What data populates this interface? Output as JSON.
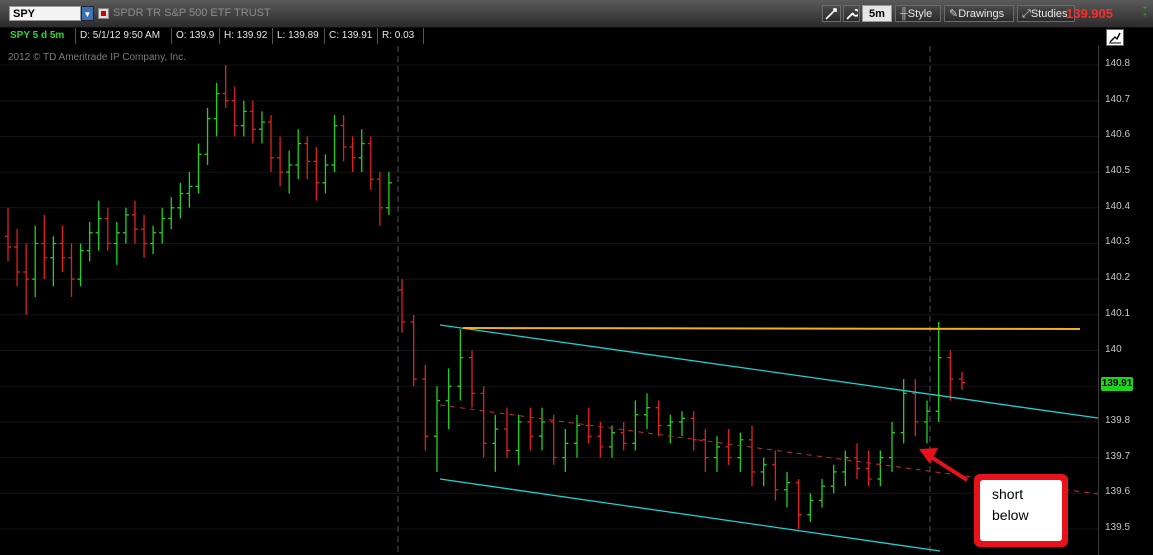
{
  "header": {
    "symbol": "SPY",
    "description": "SPDR TR S&P 500 ETF TRUST",
    "period_button": "5m",
    "style_label": "Style",
    "drawings_label": "Drawings",
    "studies_label": "Studies",
    "last_price": "139.905",
    "mini_change": "+0\n+0"
  },
  "info": {
    "chart_id": "SPY 5 d 5m",
    "date": "D: 5/1/12 9:50 AM",
    "open": "O: 139.9",
    "high": "H: 139.92",
    "low": "L: 139.89",
    "close": "C: 139.91",
    "range": "R: 0.03"
  },
  "copyright": "2012 © TD Ameritrade IP Company, Inc.",
  "annotation": {
    "line1": "short",
    "line2": "below"
  },
  "colors": {
    "up": "#22d022",
    "down": "#e02020",
    "channel": "#1fd0d0",
    "resistance": "#f0b020",
    "price_badge": "#1fd41f"
  },
  "chart_data": {
    "type": "candlestick",
    "ylim": [
      139.46,
      140.85
    ],
    "y_ticks": [
      "140.8",
      "140.7",
      "140.6",
      "140.5",
      "140.4",
      "140.3",
      "140.2",
      "140.1",
      "140",
      "139.9",
      "139.8",
      "139.7",
      "139.6",
      "139.5"
    ],
    "current_price_label": "139.91",
    "bars": [
      [
        140.32,
        140.4,
        140.25,
        140.29
      ],
      [
        140.29,
        140.34,
        140.18,
        140.22
      ],
      [
        140.22,
        140.3,
        140.1,
        140.2
      ],
      [
        140.2,
        140.35,
        140.15,
        140.3
      ],
      [
        140.3,
        140.38,
        140.2,
        140.26
      ],
      [
        140.26,
        140.32,
        140.18,
        140.3
      ],
      [
        140.3,
        140.35,
        140.22,
        140.26
      ],
      [
        140.26,
        140.3,
        140.15,
        140.2
      ],
      [
        140.2,
        140.3,
        140.18,
        140.28
      ],
      [
        140.28,
        140.36,
        140.25,
        140.33
      ],
      [
        140.33,
        140.42,
        140.28,
        140.37
      ],
      [
        140.37,
        140.4,
        140.28,
        140.3
      ],
      [
        140.3,
        140.36,
        140.24,
        140.33
      ],
      [
        140.33,
        140.4,
        140.3,
        140.38
      ],
      [
        140.38,
        140.42,
        140.3,
        140.34
      ],
      [
        140.34,
        140.38,
        140.26,
        140.3
      ],
      [
        140.3,
        140.35,
        140.27,
        140.33
      ],
      [
        140.33,
        140.4,
        140.3,
        140.37
      ],
      [
        140.37,
        140.43,
        140.34,
        140.4
      ],
      [
        140.4,
        140.47,
        140.37,
        140.44
      ],
      [
        140.44,
        140.5,
        140.4,
        140.46
      ],
      [
        140.46,
        140.58,
        140.44,
        140.55
      ],
      [
        140.55,
        140.68,
        140.52,
        140.65
      ],
      [
        140.65,
        140.75,
        140.6,
        140.72
      ],
      [
        140.72,
        140.8,
        140.68,
        140.7
      ],
      [
        140.7,
        140.74,
        140.6,
        140.63
      ],
      [
        140.63,
        140.7,
        140.6,
        140.67
      ],
      [
        140.67,
        140.7,
        140.58,
        140.62
      ],
      [
        140.62,
        140.67,
        140.58,
        140.64
      ],
      [
        140.64,
        140.66,
        140.5,
        140.54
      ],
      [
        140.54,
        140.6,
        140.46,
        140.5
      ],
      [
        140.5,
        140.56,
        140.44,
        140.52
      ],
      [
        140.52,
        140.62,
        140.48,
        140.58
      ],
      [
        140.58,
        140.6,
        140.48,
        140.53
      ],
      [
        140.53,
        140.57,
        140.42,
        140.47
      ],
      [
        140.47,
        140.55,
        140.44,
        140.52
      ],
      [
        140.52,
        140.66,
        140.5,
        140.63
      ],
      [
        140.63,
        140.66,
        140.53,
        140.57
      ],
      [
        140.57,
        140.6,
        140.5,
        140.54
      ],
      [
        140.54,
        140.62,
        140.5,
        140.58
      ],
      [
        140.58,
        140.6,
        140.45,
        140.48
      ],
      [
        140.48,
        140.5,
        140.35,
        140.4
      ],
      [
        140.4,
        140.5,
        140.38,
        140.47
      ],
      [
        140.17,
        140.2,
        140.05,
        140.08
      ],
      [
        140.08,
        140.1,
        139.9,
        139.92
      ],
      [
        139.92,
        139.96,
        139.72,
        139.76
      ],
      [
        139.76,
        139.9,
        139.66,
        139.86
      ],
      [
        139.86,
        139.95,
        139.78,
        139.9
      ],
      [
        139.9,
        140.06,
        139.86,
        139.98
      ],
      [
        139.98,
        140.0,
        139.84,
        139.88
      ],
      [
        139.88,
        139.9,
        139.7,
        139.74
      ],
      [
        139.74,
        139.82,
        139.66,
        139.78
      ],
      [
        139.78,
        139.84,
        139.7,
        139.72
      ],
      [
        139.72,
        139.82,
        139.68,
        139.8
      ],
      [
        139.8,
        139.84,
        139.72,
        139.76
      ],
      [
        139.76,
        139.84,
        139.72,
        139.8
      ],
      [
        139.8,
        139.82,
        139.68,
        139.7
      ],
      [
        139.7,
        139.78,
        139.66,
        139.74
      ],
      [
        139.74,
        139.82,
        139.7,
        139.79
      ],
      [
        139.79,
        139.84,
        139.74,
        139.76
      ],
      [
        139.76,
        139.8,
        139.7,
        139.73
      ],
      [
        139.73,
        139.79,
        139.7,
        139.77
      ],
      [
        139.77,
        139.8,
        139.72,
        139.74
      ],
      [
        139.74,
        139.86,
        139.72,
        139.82
      ],
      [
        139.82,
        139.88,
        139.78,
        139.84
      ],
      [
        139.84,
        139.86,
        139.76,
        139.79
      ],
      [
        139.79,
        139.82,
        139.74,
        139.8
      ],
      [
        139.8,
        139.83,
        139.76,
        139.81
      ],
      [
        139.81,
        139.83,
        139.72,
        139.75
      ],
      [
        139.75,
        139.78,
        139.66,
        139.7
      ],
      [
        139.7,
        139.76,
        139.66,
        139.73
      ],
      [
        139.73,
        139.78,
        139.68,
        139.7
      ],
      [
        139.7,
        139.77,
        139.66,
        139.75
      ],
      [
        139.75,
        139.79,
        139.62,
        139.66
      ],
      [
        139.66,
        139.7,
        139.62,
        139.68
      ],
      [
        139.68,
        139.72,
        139.58,
        139.61
      ],
      [
        139.61,
        139.66,
        139.56,
        139.63
      ],
      [
        139.63,
        139.64,
        139.5,
        139.54
      ],
      [
        139.54,
        139.6,
        139.52,
        139.58
      ],
      [
        139.58,
        139.64,
        139.56,
        139.62
      ],
      [
        139.62,
        139.68,
        139.6,
        139.66
      ],
      [
        139.66,
        139.72,
        139.62,
        139.7
      ],
      [
        139.7,
        139.74,
        139.64,
        139.67
      ],
      [
        139.67,
        139.72,
        139.62,
        139.64
      ],
      [
        139.64,
        139.72,
        139.62,
        139.7
      ],
      [
        139.7,
        139.8,
        139.66,
        139.77
      ],
      [
        139.77,
        139.92,
        139.74,
        139.88
      ],
      [
        139.88,
        139.92,
        139.76,
        139.8
      ],
      [
        139.8,
        139.86,
        139.74,
        139.83
      ],
      [
        139.83,
        140.08,
        139.8,
        139.98
      ],
      [
        139.98,
        140.0,
        139.86,
        139.92
      ],
      [
        139.92,
        139.94,
        139.89,
        139.91
      ]
    ]
  }
}
